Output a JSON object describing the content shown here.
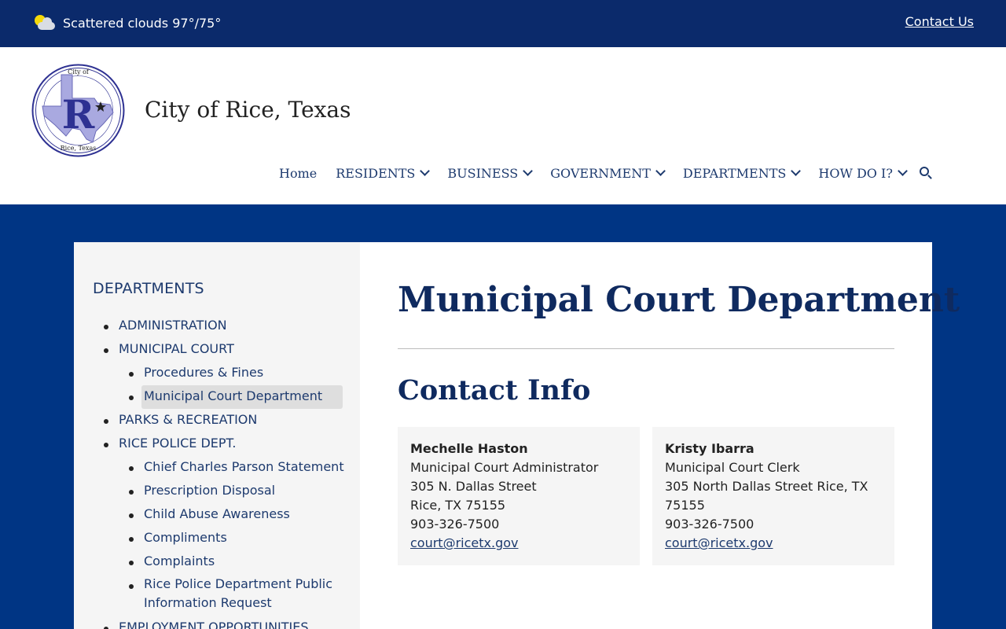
{
  "topbar": {
    "weather": "Scattered clouds 97°/75°",
    "weather_icon": "partly-cloudy-icon",
    "contact_link": "Contact Us"
  },
  "header": {
    "site_title": "City of Rice, Texas",
    "seal_text_top": "City of",
    "seal_text_bottom": "Rice, Texas",
    "seal_letter": "R",
    "nav": [
      {
        "label": "Home",
        "dropdown": false
      },
      {
        "label": "RESIDENTS",
        "dropdown": true
      },
      {
        "label": "BUSINESS",
        "dropdown": true
      },
      {
        "label": "GOVERNMENT",
        "dropdown": true
      },
      {
        "label": "DEPARTMENTS",
        "dropdown": true
      },
      {
        "label": "HOW DO I?",
        "dropdown": true
      }
    ]
  },
  "sidebar": {
    "heading": "DEPARTMENTS",
    "items": [
      {
        "label": "ADMINISTRATION",
        "level": 1
      },
      {
        "label": "MUNICIPAL COURT",
        "level": 1
      },
      {
        "label": "Procedures & Fines",
        "level": 2
      },
      {
        "label": "Municipal Court Department",
        "level": 2,
        "active": true
      },
      {
        "label": "PARKS & RECREATION",
        "level": 1
      },
      {
        "label": "RICE POLICE DEPT.",
        "level": 1
      },
      {
        "label": "Chief Charles Parson Statement",
        "level": 2
      },
      {
        "label": "Prescription Disposal",
        "level": 2
      },
      {
        "label": "Child Abuse Awareness",
        "level": 2
      },
      {
        "label": "Compliments",
        "level": 2
      },
      {
        "label": "Complaints",
        "level": 2
      },
      {
        "label": "Rice Police Department Public Information Request",
        "level": 2
      },
      {
        "label": "EMPLOYMENT OPPORTUNITIES",
        "level": 1
      }
    ]
  },
  "main": {
    "page_title": "Municipal Court Department",
    "section_title": "Contact Info",
    "contacts": [
      {
        "name": "Mechelle Haston",
        "title": "Municipal Court Administrator",
        "address1": "305 N. Dallas Street",
        "address2": "Rice, TX 75155",
        "phone": "903-326-7500",
        "email": "court@ricetx.gov"
      },
      {
        "name": "Kristy Ibarra",
        "title": "Municipal Court Clerk",
        "address1": "305 North Dallas Street Rice, TX",
        "address2": "75155",
        "phone": "903-326-7500",
        "email": "court@ricetx.gov"
      }
    ]
  },
  "colors": {
    "topbar": "#0b2a6b",
    "page_background": "#003584",
    "heading": "#0f2a5f",
    "link": "#1d3a6e"
  }
}
